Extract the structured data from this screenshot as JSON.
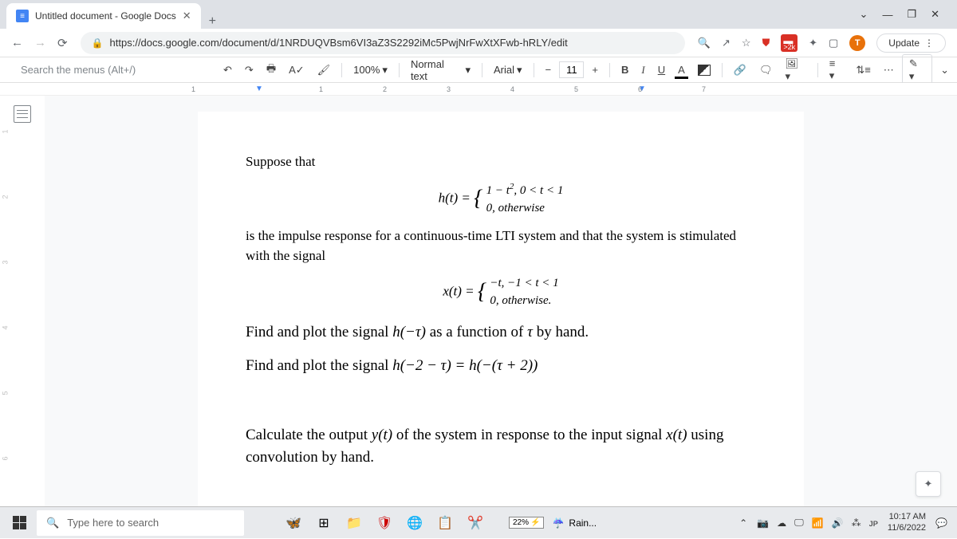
{
  "browser": {
    "tab_title": "Untitled document - Google Docs",
    "url": "https://docs.google.com/document/d/1NRDUQVBsm6VI3aZ3S2292iMc5PwjNrFwXtXFwb-hRLY/edit",
    "update_label": "Update",
    "ext_badge": ">2k",
    "profile_letter": "T"
  },
  "toolbar": {
    "menu_search_placeholder": "Search the menus (Alt+/)",
    "zoom": "100%",
    "style": "Normal text",
    "font": "Arial",
    "font_size": "11"
  },
  "ruler": {
    "marks": [
      "1",
      "1",
      "2",
      "3",
      "4",
      "5",
      "6",
      "7"
    ]
  },
  "vruler": [
    "1",
    "2",
    "3",
    "4",
    "5",
    "6"
  ],
  "document": {
    "p1": "Suppose that",
    "h_lhs": "h(t) = ",
    "h_case1_a": "1 − t",
    "h_case1_exp": "2",
    "h_case1_b": ",   0 < t < 1",
    "h_case2": "0,        otherwise",
    "p2": "is the impulse response for a continuous-time LTI system and that the system is stimulated with the signal",
    "x_lhs": "x(t) = ",
    "x_case1": "−t,   −1 < t < 1",
    "x_case2": "0,     otherwise.",
    "p3a": "Find and plot the signal ",
    "p3b": "h(−τ)",
    "p3c": " as a function of ",
    "p3d": "τ",
    "p3e": " by hand.",
    "p4a": "Find and plot the signal ",
    "p4b": "h(−2 − τ) = h(−(τ + 2))",
    "p5a": "Calculate the output ",
    "p5b": "y(t)",
    "p5c": " of the system in response to the input signal ",
    "p5d": "x(t)",
    "p5e": " using convolution by hand."
  },
  "taskbar": {
    "search_placeholder": "Type here to search",
    "battery": "22%",
    "weather": "Rain...",
    "time": "10:17 AM",
    "date": "11/6/2022"
  }
}
